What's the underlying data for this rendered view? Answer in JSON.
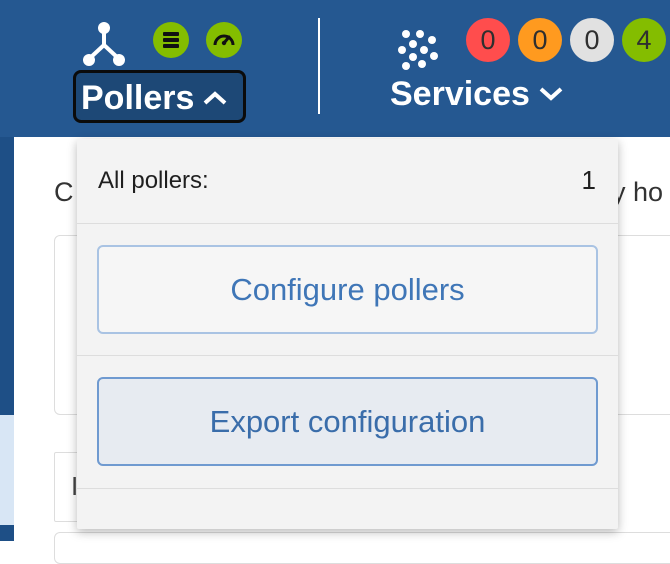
{
  "header": {
    "pollers": {
      "label": "Pollers",
      "expanded": true
    },
    "services": {
      "label": "Services"
    },
    "service_status_counts": [
      {
        "value": "0",
        "color": "#ff4d4d"
      },
      {
        "value": "0",
        "color": "#ff9a1f"
      },
      {
        "value": "0",
        "color": "#e1e1e1"
      },
      {
        "value": "4",
        "color": "#84bd00"
      }
    ],
    "colors": {
      "header_bg": "#255891",
      "poller_status_icons": "#84bd00"
    }
  },
  "background_text": {
    "left_fragment": "C",
    "right_fragment": "y ho",
    "field_fragment": "I"
  },
  "dropdown": {
    "all_pollers_label": "All pollers:",
    "all_pollers_count": "1",
    "configure_pollers_label": "Configure pollers",
    "export_configuration_label": "Export configuration"
  }
}
